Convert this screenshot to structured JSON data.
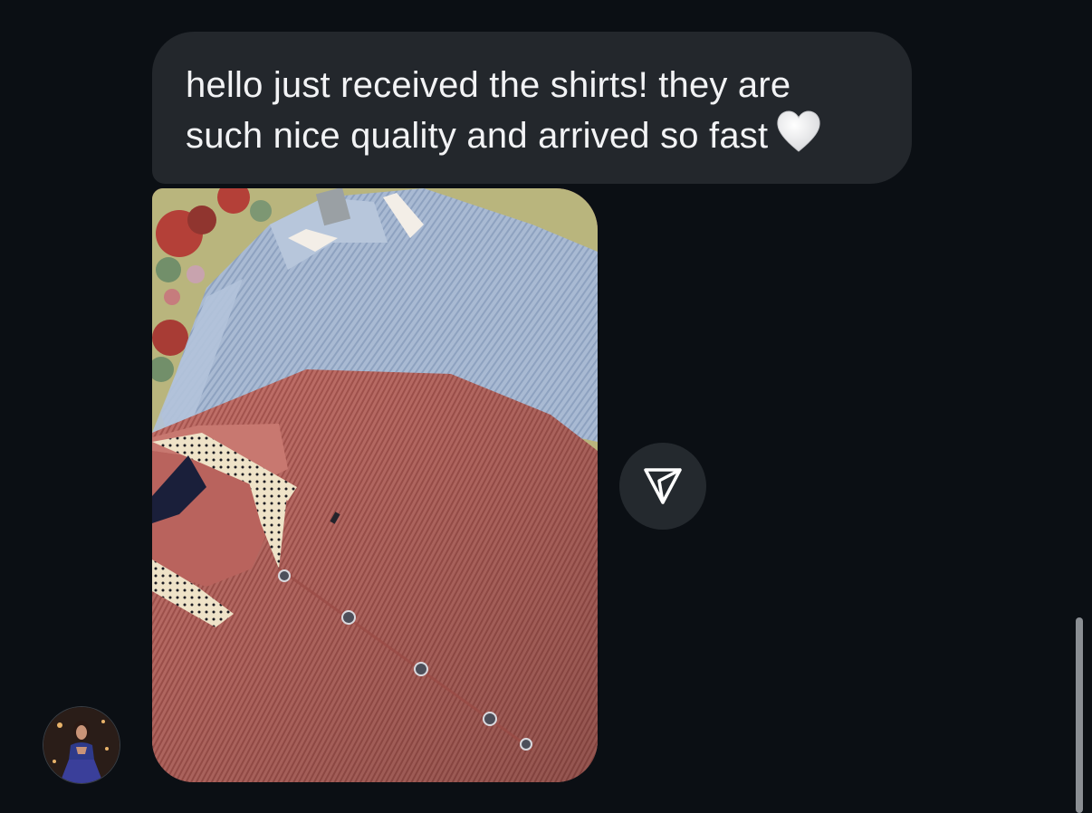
{
  "message": {
    "text": "hello just received the shirts! they are\nsuch nice quality and arrived so fast",
    "emoji_icon": "white-heart-icon"
  },
  "attachment": {
    "type": "photo",
    "subject": "two shirts"
  },
  "actions": {
    "share_icon": "paper-plane-icon"
  },
  "sender": {
    "avatar_icon": "profile-avatar"
  },
  "colors": {
    "background": "#0b0f14",
    "bubble": "#23272c",
    "text": "#f2f3f5",
    "button": "#24292e"
  }
}
